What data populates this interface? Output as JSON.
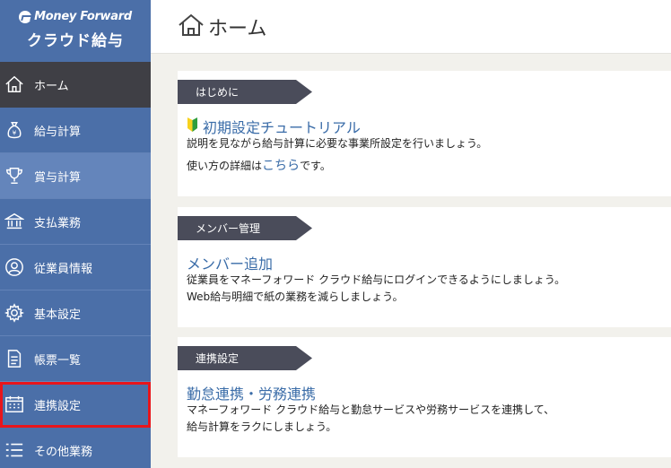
{
  "brand": {
    "top": "Money Forward",
    "bottom": "クラウド給与"
  },
  "sidebar": {
    "items": [
      {
        "label": "ホーム",
        "icon": "home-icon"
      },
      {
        "label": "給与計算",
        "icon": "money-bag-icon"
      },
      {
        "label": "賞与計算",
        "icon": "trophy-icon"
      },
      {
        "label": "支払業務",
        "icon": "bank-icon"
      },
      {
        "label": "従業員情報",
        "icon": "user-icon"
      },
      {
        "label": "基本設定",
        "icon": "gear-icon"
      },
      {
        "label": "帳票一覧",
        "icon": "document-icon"
      },
      {
        "label": "連携設定",
        "icon": "calendar-icon"
      },
      {
        "label": "その他業務",
        "icon": "list-icon"
      }
    ]
  },
  "header": {
    "title": "ホーム",
    "icon": "home-icon"
  },
  "cards": [
    {
      "tag": "はじめに",
      "link": "初期設定チュートリアル",
      "line1": "説明を見ながら給与計算に必要な事業所設定を行いましょう。",
      "line2_prefix": "使い方の詳細は",
      "line2_link": "こちら",
      "line2_suffix": "です。"
    },
    {
      "tag": "メンバー管理",
      "link": "メンバー追加",
      "line1": "従業員をマネーフォワード クラウド給与にログインできるようにしましょう。",
      "line2": "Web給与明細で紙の業務を減らしましょう。"
    },
    {
      "tag": "連携設定",
      "link": "勤怠連携・労務連携",
      "line1": "マネーフォワード クラウド給与と勤怠サービスや労務サービスを連携して、",
      "line2": "給与計算をラクにしましょう。"
    }
  ],
  "colors": {
    "sidebar": "#4b6fa8",
    "active": "#3f3f45",
    "link": "#3a6ca8",
    "highlight": "#e8151b"
  }
}
